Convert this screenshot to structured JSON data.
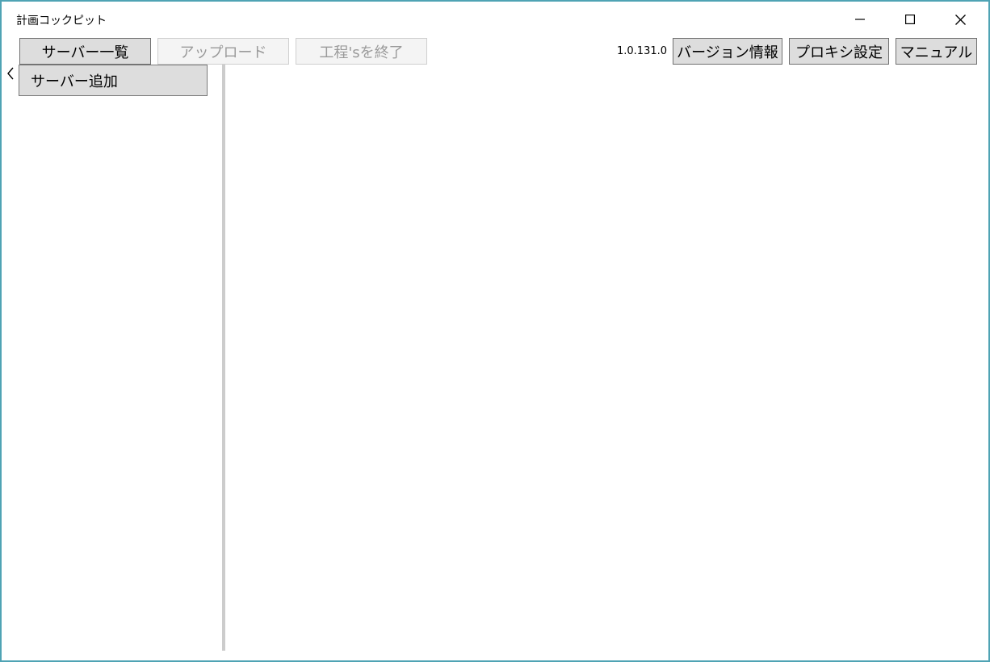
{
  "window": {
    "title": "計画コックピット"
  },
  "toolbar": {
    "server_list_label": "サーバー一覧",
    "upload_label": "アップロード",
    "end_process_label": "工程'sを終了",
    "version": "1.0.131.0",
    "version_info_label": "バージョン情報",
    "proxy_settings_label": "プロキシ設定",
    "manual_label": "マニュアル"
  },
  "sidebar": {
    "items": [
      {
        "label": "サーバー追加"
      }
    ]
  },
  "icons": {
    "minimize": "minimize-icon",
    "maximize": "maximize-icon",
    "close": "close-icon",
    "collapse": "chevron-left-icon"
  },
  "colors": {
    "window_border": "#4fa3b4",
    "button_bg": "#dddddd",
    "button_border": "#707070",
    "disabled_bg": "#f4f4f4",
    "disabled_text": "#9a9a9a",
    "splitter": "#cccccc"
  }
}
